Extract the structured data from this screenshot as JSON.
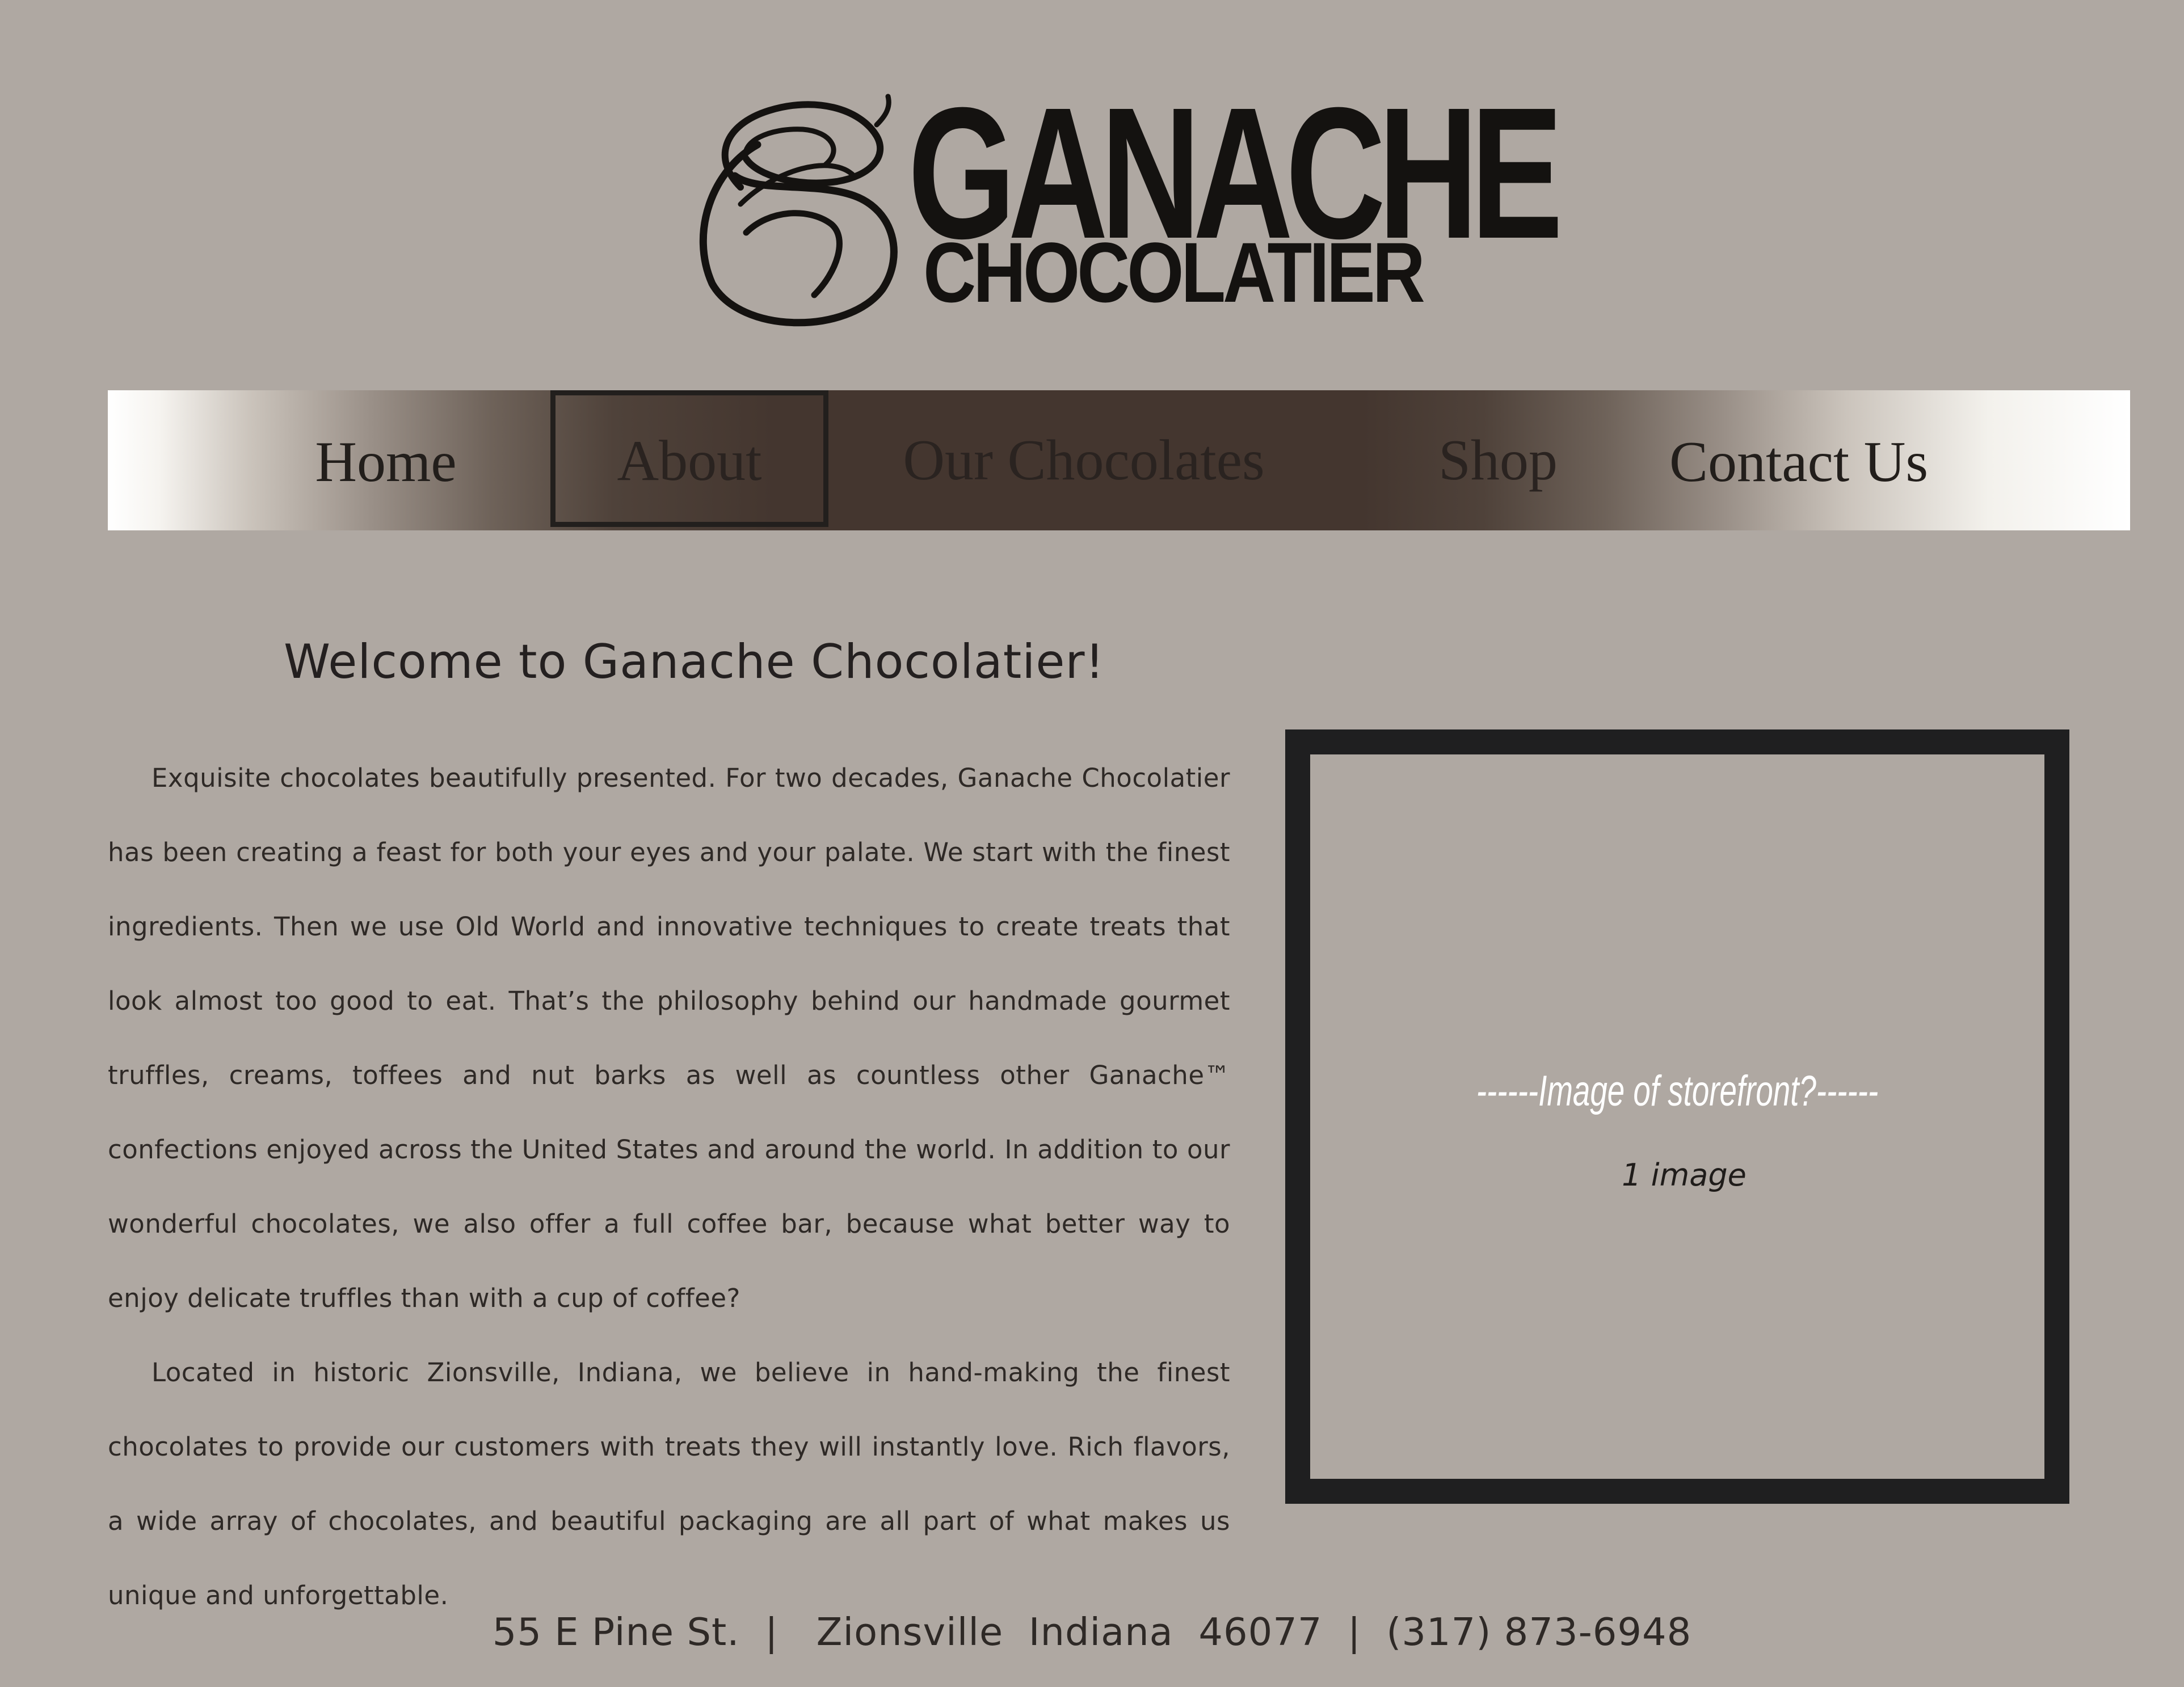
{
  "brand": {
    "name_line1": "GANACHE",
    "name_line2": "CHOCOLATIER"
  },
  "nav": {
    "items": [
      {
        "label": "Home"
      },
      {
        "label": "About"
      },
      {
        "label": "Our Chocolates"
      },
      {
        "label": "Shop"
      },
      {
        "label": "Contact Us"
      }
    ],
    "active": "About"
  },
  "main": {
    "heading": "Welcome to Ganache Chocolatier!",
    "paragraphs": [
      "Exquisite chocolates beautifully presented. For two decades, Ganache Chocolatier has been creating a feast for both your eyes and your palate.  We start with the finest ingredients. Then we use Old World and innovative techniques to create treats that look almost too good to eat. That’s the philosophy behind our handmade gourmet truffles, creams, toffees and nut barks as well as countless other Ganache™ confections enjoyed across the United States and around the world. In addition to our wonderful chocolates, we also offer a full coffee bar, because what better way to enjoy delicate truffles than with a cup of coffee?",
      "Located in historic Zionsville, Indiana, we believe in hand-making the finest chocolates to provide our customers with treats they will instantly love. Rich flavors, a wide array of chocolates, and beautiful packaging are all part of what makes us unique and unforgettable."
    ]
  },
  "image_placeholder": {
    "caption": "------Image of storefront?------",
    "count": "1 image"
  },
  "footer": {
    "address": "55 E Pine St.  |   Zionsville  Indiana  46077  |  (317) 873-6948"
  },
  "colors": {
    "background": "#afa8a2",
    "nav_dark": "#44362f",
    "text": "#2a2522",
    "frame": "#1f1f20"
  }
}
